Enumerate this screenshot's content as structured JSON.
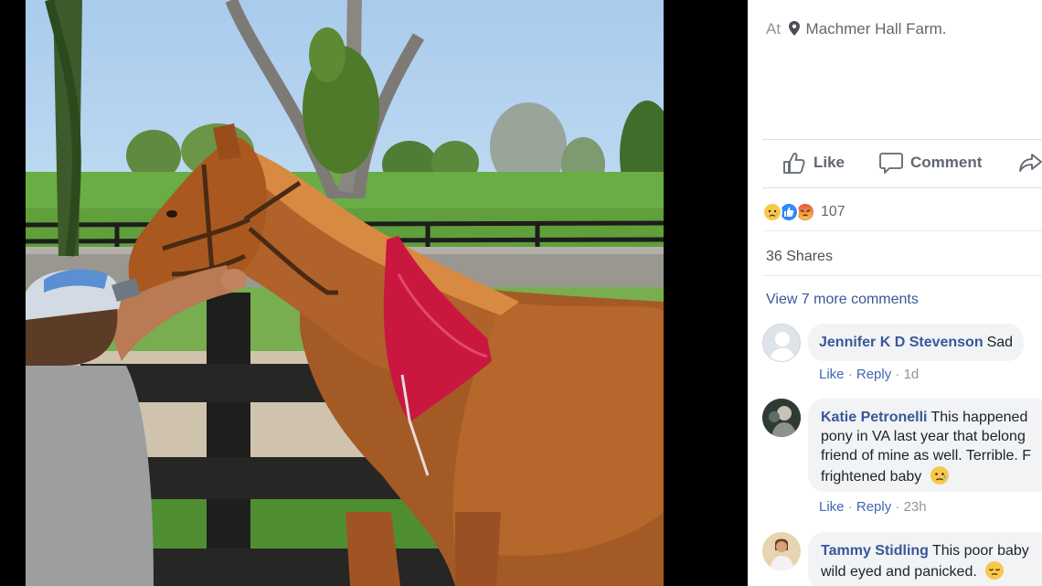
{
  "post": {
    "location_prefix": "At",
    "location_name": "Machmer Hall Farm."
  },
  "actions": {
    "like_label": "Like",
    "comment_label": "Comment"
  },
  "reactions": {
    "icons": [
      "sad-face",
      "like-thumb",
      "angry-face"
    ],
    "count": "107"
  },
  "shares_label": "36 Shares",
  "view_more_label": "View 7 more comments",
  "comments": [
    {
      "author": "Jennifer K D Stevenson",
      "lines": [
        "Sad"
      ],
      "like": "Like",
      "reply": "Reply",
      "time": "1d"
    },
    {
      "author": "Katie Petronelli",
      "lines": [
        "This happened",
        "pony in VA last year that belong",
        "friend of mine as well. Terrible. F",
        "frightened baby"
      ],
      "like": "Like",
      "reply": "Reply",
      "time": "23h"
    },
    {
      "author": "Tammy Stidling",
      "lines": [
        "This poor baby",
        "wild eyed and panicked."
      ]
    }
  ],
  "colors": {
    "link": "#385898",
    "bubble": "#f2f3f5",
    "muted": "#90949c"
  }
}
